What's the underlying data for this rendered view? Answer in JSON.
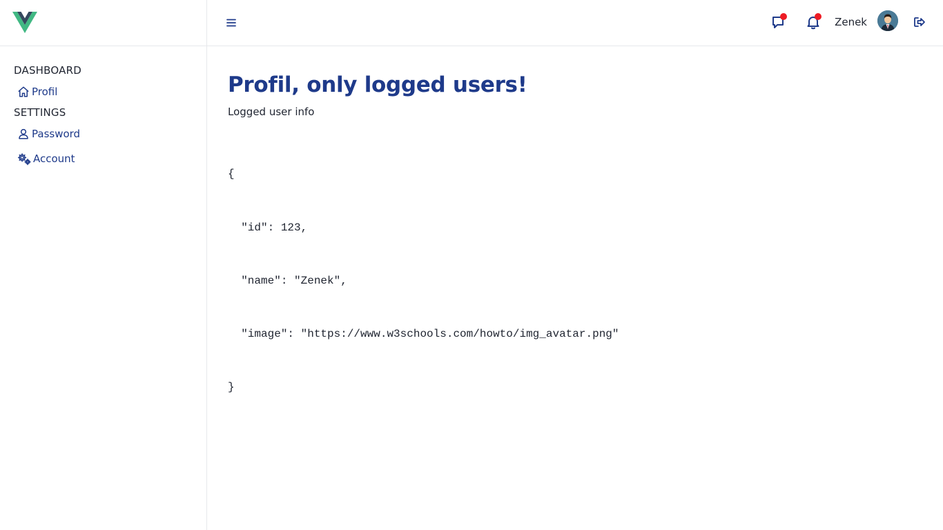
{
  "sidebar": {
    "sections": [
      {
        "label": "DASHBOARD",
        "items": [
          {
            "label": "Profil",
            "icon": "home-icon"
          }
        ]
      },
      {
        "label": "SETTINGS",
        "items": [
          {
            "label": "Password",
            "icon": "user-icon"
          },
          {
            "label": "Account",
            "icon": "gears-icon"
          }
        ]
      }
    ]
  },
  "header": {
    "menu_icon": "hamburger-icon",
    "chat_icon": "chat-icon",
    "bell_icon": "bell-icon",
    "username": "Zenek",
    "logout_icon": "logout-icon",
    "notification_color": "#ee1c25"
  },
  "main": {
    "title": "Profil, only logged users!",
    "subtitle": "Logged user info",
    "json_lines": [
      "{",
      "  \"id\": 123,",
      "  \"name\": \"Zenek\",",
      "  \"image\": \"https://www.w3schools.com/howto/img_avatar.png\"",
      "}"
    ]
  },
  "colors": {
    "accent": "#1e3a8a",
    "vue_green": "#41b883",
    "vue_dark": "#34495e"
  }
}
